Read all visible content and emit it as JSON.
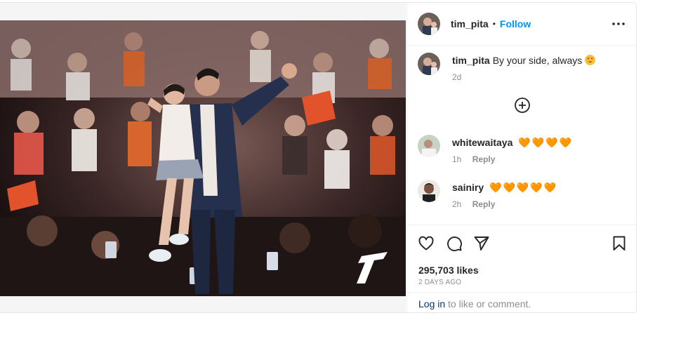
{
  "post": {
    "author": "tim_pita",
    "follow_label": "Follow",
    "separator": "•",
    "caption": {
      "username": "tim_pita",
      "text": "By your side, always",
      "age": "2d"
    },
    "comments": [
      {
        "username": "whitewaitaya",
        "text": "🧡🧡🧡🧡",
        "age": "1h",
        "reply_label": "Reply"
      },
      {
        "username": "sainiry",
        "text": "🧡🧡🧡🧡🧡",
        "age": "2h",
        "reply_label": "Reply"
      }
    ],
    "likes": "295,703 likes",
    "posted_ago": "2 DAYS AGO",
    "login_link": "Log in",
    "login_rest": " to like or comment."
  },
  "colors": {
    "accent": "#0095f6",
    "heart": "#f07a1c",
    "muted": "#8e8e8e",
    "text": "#262626"
  },
  "icons": [
    "more-icon",
    "load-more-plus-icon",
    "heart-icon",
    "comment-icon",
    "share-icon",
    "bookmark-icon"
  ]
}
